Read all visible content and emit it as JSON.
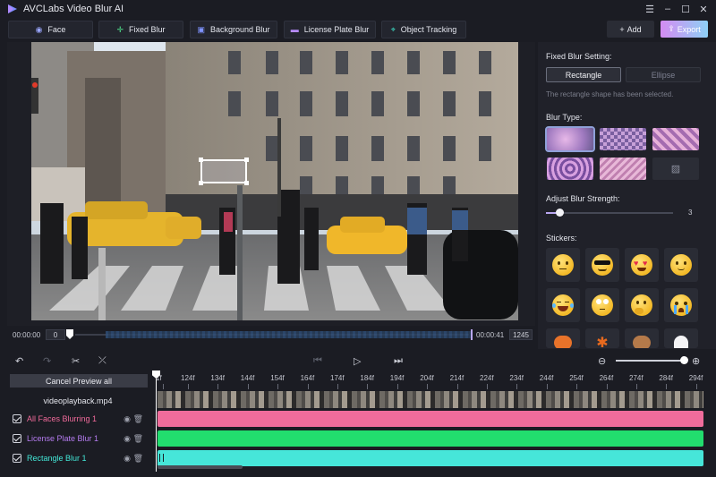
{
  "app": {
    "title": "AVCLabs Video Blur AI"
  },
  "toolbar": {
    "tabs": [
      {
        "label": "Face",
        "icon": "face-icon"
      },
      {
        "label": "Fixed Blur",
        "icon": "crosshair-icon"
      },
      {
        "label": "Background Blur",
        "icon": "image-frame-icon"
      },
      {
        "label": "License Plate Blur",
        "icon": "car-icon"
      },
      {
        "label": "Object Tracking",
        "icon": "target-icon"
      }
    ],
    "add_label": "Add",
    "export_label": "Export"
  },
  "preview": {
    "time_start": "00:00:00",
    "frame_start": "0",
    "time_end": "00:00:41",
    "frame_end": "1245"
  },
  "side_panel": {
    "fixed_blur_heading": "Fixed Blur Setting:",
    "shape_options": [
      "Rectangle",
      "Ellipse"
    ],
    "selected_shape": "Rectangle",
    "hint": "The rectangle shape has been selected.",
    "blur_type_heading": "Blur Type:",
    "strength_heading": "Adjust Blur Strength:",
    "strength_value": "3",
    "strength_fraction": 0.1,
    "stickers_heading": "Stickers:"
  },
  "timeline": {
    "cancel_preview_label": "Cancel Preview all",
    "video_track_name": "videoplayback.mp4",
    "tracks": [
      {
        "name": "All Faces Blurring 1",
        "color": "#f06a9a"
      },
      {
        "name": "License Plate Blur 1",
        "color": "#b57cf0"
      },
      {
        "name": "Rectangle Blur 1",
        "color": "#43e8d8"
      }
    ],
    "ruler_ticks": [
      "1f",
      "124f",
      "134f",
      "144f",
      "154f",
      "164f",
      "174f",
      "184f",
      "194f",
      "204f",
      "214f",
      "224f",
      "234f",
      "244f",
      "254f",
      "264f",
      "274f",
      "284f",
      "294f"
    ]
  },
  "colors": {
    "bar_faces": "#f06c9b",
    "bar_plate": "#22dd6e",
    "bar_rect": "#46e6d9",
    "accent": "#b9a6f0"
  }
}
